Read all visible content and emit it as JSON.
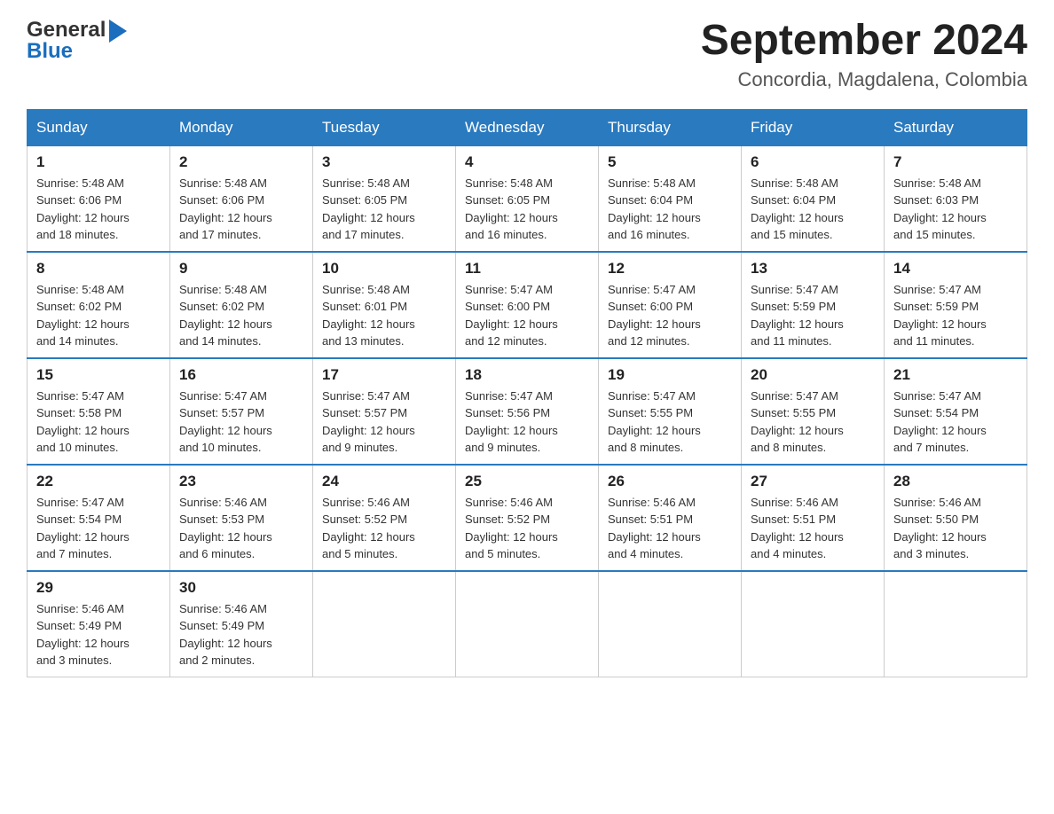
{
  "header": {
    "month_year": "September 2024",
    "location": "Concordia, Magdalena, Colombia"
  },
  "logo": {
    "line1": "General",
    "line2": "Blue"
  },
  "days_of_week": [
    "Sunday",
    "Monday",
    "Tuesday",
    "Wednesday",
    "Thursday",
    "Friday",
    "Saturday"
  ],
  "weeks": [
    [
      {
        "day": "1",
        "sunrise": "5:48 AM",
        "sunset": "6:06 PM",
        "daylight": "12 hours and 18 minutes."
      },
      {
        "day": "2",
        "sunrise": "5:48 AM",
        "sunset": "6:06 PM",
        "daylight": "12 hours and 17 minutes."
      },
      {
        "day": "3",
        "sunrise": "5:48 AM",
        "sunset": "6:05 PM",
        "daylight": "12 hours and 17 minutes."
      },
      {
        "day": "4",
        "sunrise": "5:48 AM",
        "sunset": "6:05 PM",
        "daylight": "12 hours and 16 minutes."
      },
      {
        "day": "5",
        "sunrise": "5:48 AM",
        "sunset": "6:04 PM",
        "daylight": "12 hours and 16 minutes."
      },
      {
        "day": "6",
        "sunrise": "5:48 AM",
        "sunset": "6:04 PM",
        "daylight": "12 hours and 15 minutes."
      },
      {
        "day": "7",
        "sunrise": "5:48 AM",
        "sunset": "6:03 PM",
        "daylight": "12 hours and 15 minutes."
      }
    ],
    [
      {
        "day": "8",
        "sunrise": "5:48 AM",
        "sunset": "6:02 PM",
        "daylight": "12 hours and 14 minutes."
      },
      {
        "day": "9",
        "sunrise": "5:48 AM",
        "sunset": "6:02 PM",
        "daylight": "12 hours and 14 minutes."
      },
      {
        "day": "10",
        "sunrise": "5:48 AM",
        "sunset": "6:01 PM",
        "daylight": "12 hours and 13 minutes."
      },
      {
        "day": "11",
        "sunrise": "5:47 AM",
        "sunset": "6:00 PM",
        "daylight": "12 hours and 12 minutes."
      },
      {
        "day": "12",
        "sunrise": "5:47 AM",
        "sunset": "6:00 PM",
        "daylight": "12 hours and 12 minutes."
      },
      {
        "day": "13",
        "sunrise": "5:47 AM",
        "sunset": "5:59 PM",
        "daylight": "12 hours and 11 minutes."
      },
      {
        "day": "14",
        "sunrise": "5:47 AM",
        "sunset": "5:59 PM",
        "daylight": "12 hours and 11 minutes."
      }
    ],
    [
      {
        "day": "15",
        "sunrise": "5:47 AM",
        "sunset": "5:58 PM",
        "daylight": "12 hours and 10 minutes."
      },
      {
        "day": "16",
        "sunrise": "5:47 AM",
        "sunset": "5:57 PM",
        "daylight": "12 hours and 10 minutes."
      },
      {
        "day": "17",
        "sunrise": "5:47 AM",
        "sunset": "5:57 PM",
        "daylight": "12 hours and 9 minutes."
      },
      {
        "day": "18",
        "sunrise": "5:47 AM",
        "sunset": "5:56 PM",
        "daylight": "12 hours and 9 minutes."
      },
      {
        "day": "19",
        "sunrise": "5:47 AM",
        "sunset": "5:55 PM",
        "daylight": "12 hours and 8 minutes."
      },
      {
        "day": "20",
        "sunrise": "5:47 AM",
        "sunset": "5:55 PM",
        "daylight": "12 hours and 8 minutes."
      },
      {
        "day": "21",
        "sunrise": "5:47 AM",
        "sunset": "5:54 PM",
        "daylight": "12 hours and 7 minutes."
      }
    ],
    [
      {
        "day": "22",
        "sunrise": "5:47 AM",
        "sunset": "5:54 PM",
        "daylight": "12 hours and 7 minutes."
      },
      {
        "day": "23",
        "sunrise": "5:46 AM",
        "sunset": "5:53 PM",
        "daylight": "12 hours and 6 minutes."
      },
      {
        "day": "24",
        "sunrise": "5:46 AM",
        "sunset": "5:52 PM",
        "daylight": "12 hours and 5 minutes."
      },
      {
        "day": "25",
        "sunrise": "5:46 AM",
        "sunset": "5:52 PM",
        "daylight": "12 hours and 5 minutes."
      },
      {
        "day": "26",
        "sunrise": "5:46 AM",
        "sunset": "5:51 PM",
        "daylight": "12 hours and 4 minutes."
      },
      {
        "day": "27",
        "sunrise": "5:46 AM",
        "sunset": "5:51 PM",
        "daylight": "12 hours and 4 minutes."
      },
      {
        "day": "28",
        "sunrise": "5:46 AM",
        "sunset": "5:50 PM",
        "daylight": "12 hours and 3 minutes."
      }
    ],
    [
      {
        "day": "29",
        "sunrise": "5:46 AM",
        "sunset": "5:49 PM",
        "daylight": "12 hours and 3 minutes."
      },
      {
        "day": "30",
        "sunrise": "5:46 AM",
        "sunset": "5:49 PM",
        "daylight": "12 hours and 2 minutes."
      },
      null,
      null,
      null,
      null,
      null
    ]
  ]
}
